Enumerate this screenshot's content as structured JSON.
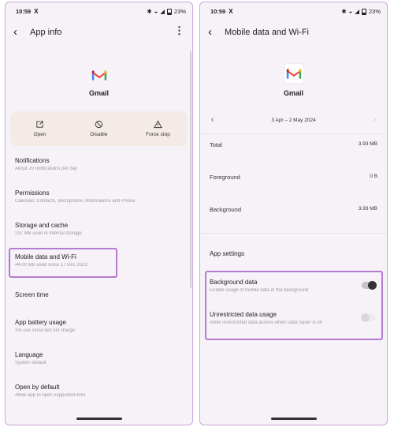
{
  "status_bar": {
    "time": "10:59",
    "x_icon": "X",
    "battery": "23%"
  },
  "left": {
    "title": "App info",
    "app_name": "Gmail",
    "actions": [
      {
        "label": "Open",
        "icon": "open-in-icon"
      },
      {
        "label": "Disable",
        "icon": "disable-icon"
      },
      {
        "label": "Force stop",
        "icon": "warning-triangle-icon"
      }
    ],
    "items": [
      {
        "title": "Notifications",
        "subtitle": "About 20 notifications per day"
      },
      {
        "title": "Permissions",
        "subtitle": "Calendar, Contacts, Microphone, Notifications and Phone"
      },
      {
        "title": "Storage and cache",
        "subtitle": "237 MB used in internal storage"
      },
      {
        "title": "Mobile data and Wi-Fi",
        "subtitle": "44.00 MB used since 17 Dec 2023"
      },
      {
        "title": "Screen time",
        "subtitle": ""
      },
      {
        "title": "App battery usage",
        "subtitle": "2% use since last full charge"
      },
      {
        "title": "Language",
        "subtitle": "System default"
      },
      {
        "title": "Open by default",
        "subtitle": "Allow app to open supported links"
      }
    ]
  },
  "right": {
    "title": "Mobile data and Wi-Fi",
    "app_name": "Gmail",
    "date_range": "3 Apr – 2 May 2024",
    "stats": [
      {
        "label": "Total",
        "value": "3.93 MB"
      },
      {
        "label": "Foreground",
        "value": "0 B"
      },
      {
        "label": "Background",
        "value": "3.93 MB"
      }
    ],
    "settings_title": "App settings",
    "settings": [
      {
        "title": "Background data",
        "subtitle": "Enable usage of mobile data in the background",
        "enabled": true
      },
      {
        "title": "Unrestricted data usage",
        "subtitle": "Allow unrestricted data access when Data Saver is on",
        "enabled": false
      }
    ]
  },
  "colors": {
    "highlight": "#b57bd1",
    "action_bg": "#f5ebe6",
    "screen_bg": "#f7f2f8"
  }
}
